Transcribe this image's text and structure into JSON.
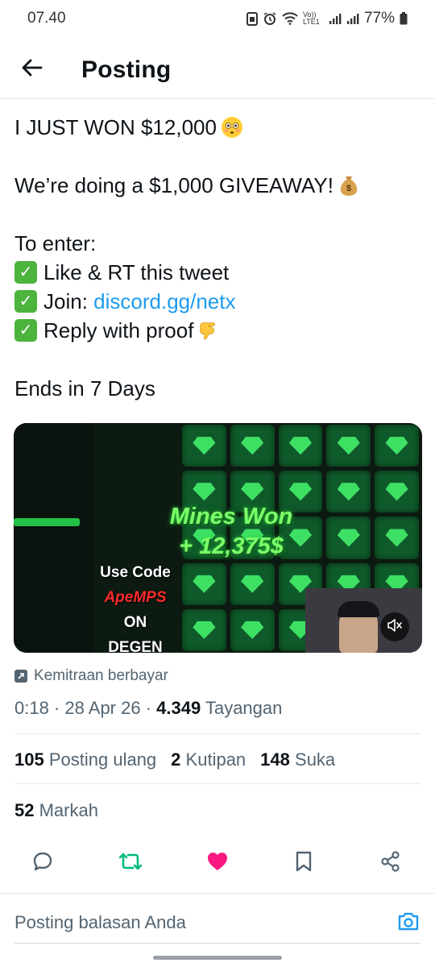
{
  "status_bar": {
    "time": "07.40",
    "network_label": "Vo)) LTE1",
    "battery": "77%"
  },
  "header": {
    "title": "Posting"
  },
  "tweet": {
    "line1": "I JUST WON $12,000",
    "line1_emoji": "flushed-face",
    "line2": "We’re doing a $1,000 GIVEAWAY!",
    "line2_emoji": "money-bag",
    "line3": "To enter:",
    "line4": "Like & RT this tweet",
    "line5_prefix": "Join: ",
    "line5_link": "discord.gg/netx",
    "line6": "Reply with proof",
    "line6_emoji": "backhand-index-pointing-down",
    "line7": "Ends in 7 Days"
  },
  "media": {
    "banner_title": "Mines Won",
    "banner_amount": "+ 12,375$",
    "promo_line1": "Use Code",
    "promo_line2": "ApeMPS",
    "promo_line3": "ON",
    "promo_line4": "DEGEN",
    "accent_green": "#3ee064",
    "promo_red": "#ff2a2a"
  },
  "paid_partnership": {
    "label": "Kemitraan berbayar"
  },
  "meta": {
    "time": "0:18",
    "date": "28 Apr 26",
    "views_count": "4.349",
    "views_label": "Tayangan"
  },
  "stats": {
    "reposts_count": "105",
    "reposts_label": "Posting ulang",
    "quotes_count": "2",
    "quotes_label": "Kutipan",
    "likes_count": "148",
    "likes_label": "Suka",
    "bookmarks_count": "52",
    "bookmarks_label": "Markah"
  },
  "actions": {
    "icons": [
      "reply-icon",
      "repost-icon",
      "like-icon",
      "bookmark-icon",
      "share-icon"
    ],
    "repost_color": "#00ba7c",
    "like_color": "#f91880"
  },
  "reply": {
    "placeholder": "Posting balasan Anda",
    "accent": "#1d9bf0"
  }
}
